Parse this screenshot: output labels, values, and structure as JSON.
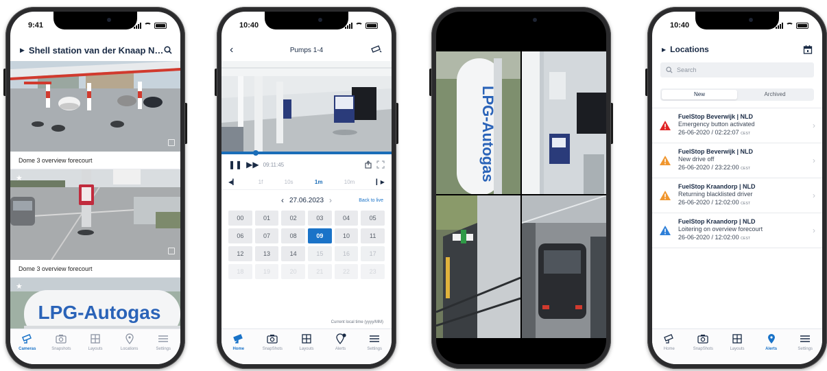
{
  "colors": {
    "accent": "#1a73c8",
    "danger": "#e02424",
    "warning": "#f0962e",
    "info": "#2f80d8"
  },
  "phone1": {
    "time": "9:41",
    "title": "Shell station van der Knaap NL...",
    "cameras": [
      {
        "caption": "Dome 3 overview forecourt",
        "starred": false
      },
      {
        "caption": "Dome 3 overview forecourt",
        "starred": true
      },
      {
        "caption": "",
        "starred": true,
        "sign_text": "LPG-Autogas"
      }
    ],
    "tabs": [
      {
        "label": "Cameras",
        "icon": "camera-icon",
        "active": true
      },
      {
        "label": "Snapshots",
        "icon": "snapshot-icon",
        "active": false
      },
      {
        "label": "Layouts",
        "icon": "layouts-icon",
        "active": false
      },
      {
        "label": "Locations",
        "icon": "location-pin-icon",
        "active": false
      },
      {
        "label": "Settings",
        "icon": "menu-icon",
        "active": false
      }
    ]
  },
  "phone2": {
    "time": "10:40",
    "title": "Pumps 1-4",
    "playback_time": "09:11:45",
    "zoom": {
      "a": "1f",
      "b": "10s",
      "c": "1m",
      "d": "10m"
    },
    "date": "27.06.2023",
    "back_to_live": "Back to live",
    "hours": [
      "00",
      "01",
      "02",
      "03",
      "04",
      "05",
      "06",
      "07",
      "08",
      "09",
      "10",
      "11",
      "12",
      "13",
      "14",
      "15",
      "16",
      "17",
      "18",
      "19",
      "20",
      "21",
      "22",
      "23"
    ],
    "selected_hour": "09",
    "footnote": "Current local time (yyyy/MM)",
    "tabs": [
      {
        "label": "Home",
        "icon": "camera-icon",
        "active": true
      },
      {
        "label": "SnapShots",
        "icon": "snapshot-icon",
        "active": false
      },
      {
        "label": "Layouts",
        "icon": "layouts-icon",
        "active": false
      },
      {
        "label": "Alerts",
        "icon": "alert-pin-icon",
        "active": false
      },
      {
        "label": "Settings",
        "icon": "menu-icon",
        "active": false
      }
    ]
  },
  "phone3": {
    "sign_text": "LPG-Autogas"
  },
  "phone4": {
    "time": "10:40",
    "title": "Locations",
    "search_placeholder": "Search",
    "segments": [
      "New",
      "Archived"
    ],
    "alerts": [
      {
        "site": "FuelStop Beverwijk | NLD",
        "event": "Emergency button activated",
        "time": "26-06-2020 / 02:22:07",
        "tz": "CEST",
        "level": "danger"
      },
      {
        "site": "FuelStop Beverwijk | NLD",
        "event": "New drive off",
        "time": "26-06-2020 / 23:22:00",
        "tz": "CEST",
        "level": "warning"
      },
      {
        "site": "FuelStop Kraandorp | NLD",
        "event": "Returning blacklisted driver",
        "time": "26-06-2020 / 12:02:00",
        "tz": "CEST",
        "level": "warning"
      },
      {
        "site": "FuelStop Kraandorp | NLD",
        "event": "Loitering on overview forecourt",
        "time": "26-06-2020 / 12:02:00",
        "tz": "CEST",
        "level": "info"
      }
    ],
    "tabs": [
      {
        "label": "Home",
        "icon": "camera-icon",
        "active": false
      },
      {
        "label": "SnapShots",
        "icon": "snapshot-icon",
        "active": false
      },
      {
        "label": "Layouts",
        "icon": "layouts-icon",
        "active": false
      },
      {
        "label": "Alerts",
        "icon": "location-pin-icon",
        "active": true
      },
      {
        "label": "Settings",
        "icon": "menu-icon",
        "active": false
      }
    ]
  }
}
